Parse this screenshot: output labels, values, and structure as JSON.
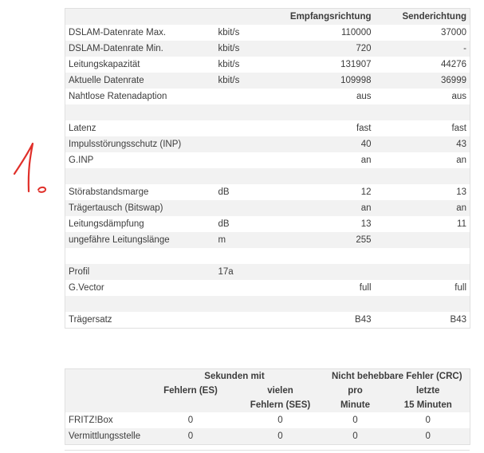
{
  "dsl_table": {
    "headers": [
      "",
      "",
      "Empfangsrichtung",
      "Senderichtung"
    ],
    "rows": [
      [
        "DSLAM-Datenrate Max.",
        "kbit/s",
        "110000",
        "37000"
      ],
      [
        "DSLAM-Datenrate Min.",
        "kbit/s",
        "720",
        "-"
      ],
      [
        "Leitungskapazität",
        "kbit/s",
        "131907",
        "44276"
      ],
      [
        "Aktuelle Datenrate",
        "kbit/s",
        "109998",
        "36999"
      ],
      [
        "Nahtlose Ratenadaption",
        "",
        "aus",
        "aus"
      ],
      [
        "",
        "",
        "",
        ""
      ],
      [
        "Latenz",
        "",
        "fast",
        "fast"
      ],
      [
        "Impulsstörungsschutz (INP)",
        "",
        "40",
        "43"
      ],
      [
        "G.INP",
        "",
        "an",
        "an"
      ],
      [
        "",
        "",
        "",
        ""
      ],
      [
        "Störabstandsmarge",
        "dB",
        "12",
        "13"
      ],
      [
        "Trägertausch (Bitswap)",
        "",
        "an",
        "an"
      ],
      [
        "Leitungsdämpfung",
        "dB",
        "13",
        "11"
      ],
      [
        "ungefähre Leitungslänge",
        "m",
        "255",
        ""
      ],
      [
        "",
        "",
        "",
        ""
      ],
      [
        "Profil",
        "17a",
        "",
        ""
      ],
      [
        "G.Vector",
        "",
        "full",
        "full"
      ],
      [
        "",
        "",
        "",
        ""
      ],
      [
        "Trägersatz",
        "",
        "B43",
        "B43"
      ]
    ]
  },
  "error_table": {
    "group_headers": [
      "",
      "Sekunden mit",
      "Nicht behebbare Fehler (CRC)"
    ],
    "sub_headers": [
      [
        "",
        ""
      ],
      [
        "Fehlern (ES)",
        ""
      ],
      [
        "vielen",
        "Fehlern (SES)"
      ],
      [
        "pro",
        "Minute"
      ],
      [
        "letzte",
        "15 Minuten"
      ]
    ],
    "rows": [
      [
        "FRITZ!Box",
        "0",
        "0",
        "0",
        "0"
      ],
      [
        "Vermittlungsstelle",
        "0",
        "0",
        "0",
        "0"
      ]
    ]
  },
  "annotation": {
    "text": "1.",
    "color": "#e0302a"
  }
}
